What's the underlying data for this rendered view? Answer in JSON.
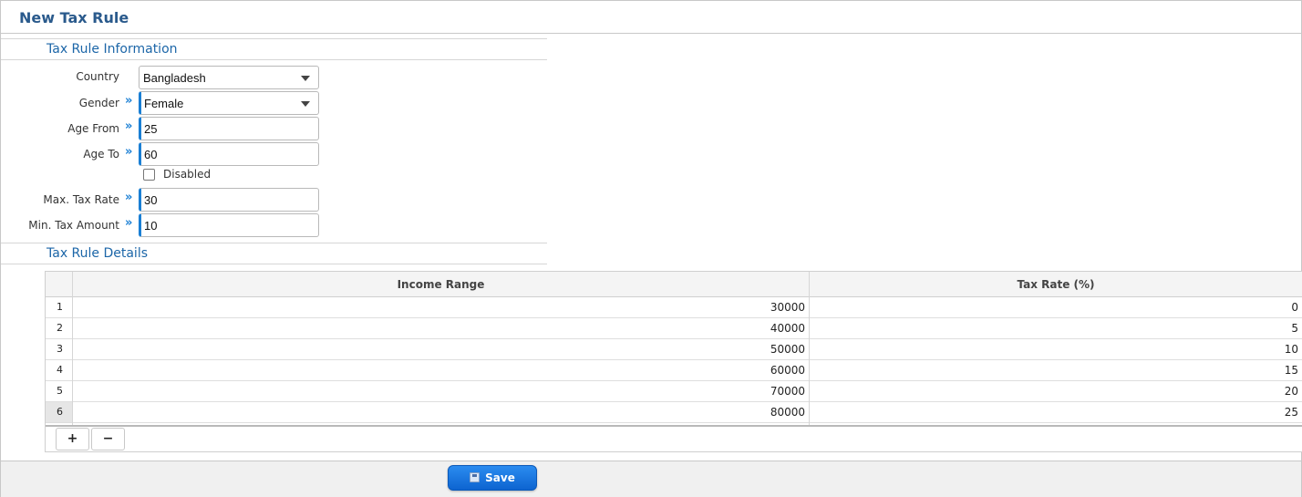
{
  "header": {
    "title": "New Tax Rule"
  },
  "info_section": {
    "title": "Tax Rule Information"
  },
  "form": {
    "country": {
      "label": "Country",
      "value": "Bangladesh"
    },
    "gender": {
      "label": "Gender",
      "value": "Female"
    },
    "age_from": {
      "label": "Age From",
      "value": "25"
    },
    "age_to": {
      "label": "Age To",
      "value": "60"
    },
    "disabled": {
      "label": "Disabled",
      "checked": false
    },
    "max_tax_rate": {
      "label": "Max. Tax Rate",
      "value": "30"
    },
    "min_tax_amount": {
      "label": "Min. Tax Amount",
      "value": "10"
    },
    "required_marker": "»"
  },
  "details_section": {
    "title": "Tax Rule Details"
  },
  "grid": {
    "columns": [
      "Income Range",
      "Tax Rate (%)"
    ],
    "rows": [
      {
        "num": "1",
        "income": "30000",
        "rate": "0"
      },
      {
        "num": "2",
        "income": "40000",
        "rate": "5"
      },
      {
        "num": "3",
        "income": "50000",
        "rate": "10"
      },
      {
        "num": "4",
        "income": "60000",
        "rate": "15"
      },
      {
        "num": "5",
        "income": "70000",
        "rate": "20"
      },
      {
        "num": "6",
        "income": "80000",
        "rate": "25"
      }
    ],
    "add_label": "+",
    "remove_label": "−"
  },
  "footer": {
    "save_label": "Save"
  },
  "colors": {
    "accent": "#1a7fd4",
    "title": "#2a5a8c",
    "section": "#1c66a8",
    "save_button": "#1576e0"
  },
  "icons": {
    "save": "floppy-disk-icon",
    "dropdown": "caret-down-icon",
    "required": "double-chevron-right-icon"
  }
}
